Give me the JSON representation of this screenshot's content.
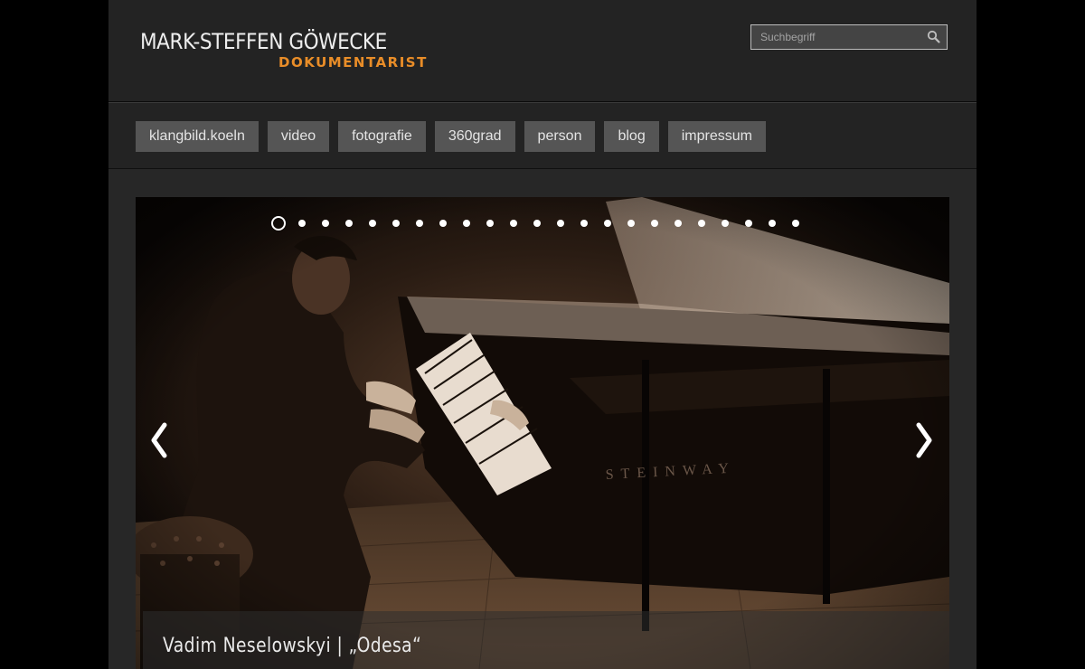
{
  "header": {
    "site_name": "MARK-STEFFEN GÖWECKE",
    "site_subtitle": "DOKUMENTARIST",
    "search_placeholder": "Suchbegriff",
    "search_icon": "search-icon"
  },
  "nav": {
    "items": [
      {
        "label": "klangbild.koeln"
      },
      {
        "label": "video"
      },
      {
        "label": "fotografie"
      },
      {
        "label": "360grad"
      },
      {
        "label": "person"
      },
      {
        "label": "blog"
      },
      {
        "label": "impressum"
      }
    ]
  },
  "slider": {
    "slide_count": 23,
    "active_index": 1,
    "prev_icon": "chevron-left-icon",
    "next_icon": "chevron-right-icon",
    "caption": "Vadim Neselowskyi | „Odesa“"
  },
  "colors": {
    "accent": "#e98d28",
    "background": "#000000",
    "page": "#272727",
    "nav_button": "#555555"
  }
}
